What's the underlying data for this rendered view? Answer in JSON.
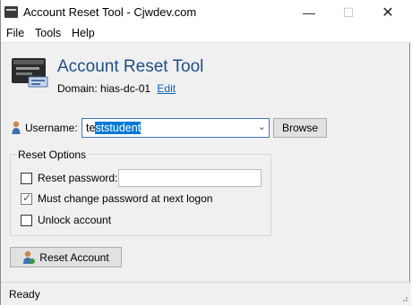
{
  "window": {
    "title": "Account Reset Tool - Cjwdev.com",
    "controls": {
      "minimize": "—",
      "maximize": "☐",
      "close": "✕"
    }
  },
  "menu": [
    "File",
    "Tools",
    "Help"
  ],
  "header": {
    "title": "Account Reset Tool",
    "domain_label": "Domain:",
    "domain_value": "hias-dc-01",
    "edit_link": "Edit"
  },
  "username": {
    "label": "Username:",
    "value_prefix": "te",
    "value_selected": "ststudent",
    "browse_label": "Browse"
  },
  "reset_options": {
    "legend": "Reset Options",
    "reset_password": {
      "label": "Reset password:",
      "checked": false,
      "value": ""
    },
    "must_change": {
      "label": "Must change password at next logon",
      "checked": true
    },
    "unlock": {
      "label": "Unlock account",
      "checked": false
    }
  },
  "reset_button": {
    "label": "Reset Account"
  },
  "status": {
    "text": "Ready"
  },
  "colors": {
    "title_blue": "#1d4e89",
    "link": "#0a5fb8",
    "selection": "#0078d7",
    "focus_border": "#3a78c8"
  }
}
